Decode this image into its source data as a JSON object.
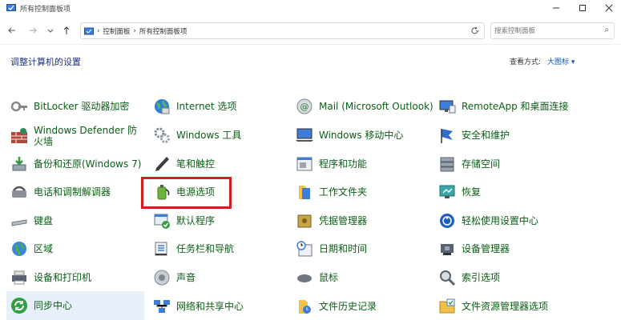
{
  "window": {
    "title": "所有控制面板项"
  },
  "addressbar": {
    "crumbs": [
      "控制面板",
      "所有控制面板项"
    ],
    "search_placeholder": "搜索控制面板"
  },
  "header": {
    "heading": "调整计算机的设置",
    "view_by_label": "查看方式:",
    "view_by_value": "大图标 ▾"
  },
  "items": {
    "c1": [
      "BitLocker 驱动器加密",
      "Windows Defender 防火墙",
      "备份和还原(Windows 7)",
      "电话和调制解调器",
      "键盘",
      "区域",
      "设备和打印机",
      "同步中心"
    ],
    "c2": [
      "Internet 选项",
      "Windows 工具",
      "笔和触控",
      "电源选项",
      "默认程序",
      "任务栏和导航",
      "声音",
      "网络和共享中心"
    ],
    "c3": [
      "Mail (Microsoft Outlook)",
      "Windows 移动中心",
      "程序和功能",
      "工作文件夹",
      "凭据管理器",
      "日期和时间",
      "鼠标",
      "文件历史记录"
    ],
    "c4": [
      "RemoteApp 和桌面连接",
      "安全和维护",
      "存储空间",
      "恢复",
      "轻松使用设置中心",
      "设备管理器",
      "索引选项",
      "文件资源管理器选项"
    ]
  }
}
